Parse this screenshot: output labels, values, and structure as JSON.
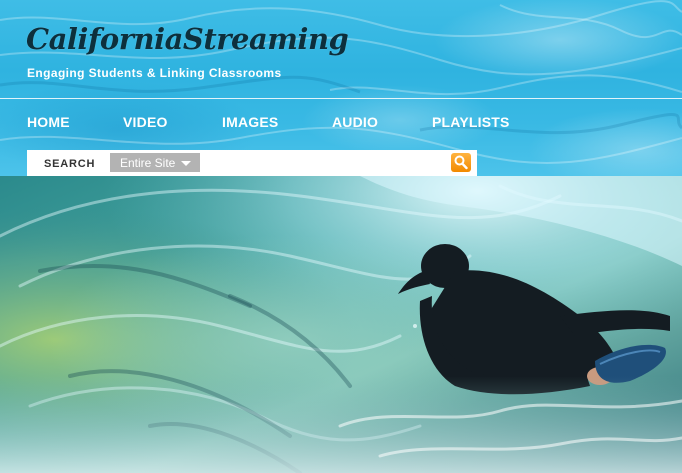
{
  "site": {
    "logo_text": "CaliforniaStreaming",
    "tagline": "Engaging Students & Linking Classrooms"
  },
  "nav": {
    "items": [
      {
        "label": "HOME"
      },
      {
        "label": "VIDEO"
      },
      {
        "label": "IMAGES"
      },
      {
        "label": "AUDIO"
      },
      {
        "label": "PLAYLISTS"
      }
    ]
  },
  "search": {
    "label": "SEARCH",
    "scope_selected": "Entire Site",
    "query": "",
    "button_icon": "magnifier-icon"
  },
  "hero": {
    "image_subject": "surfer inside a barreling wave"
  },
  "colors": {
    "header_blue": "#35b6e2",
    "logo_dark": "#0d2f3c",
    "search_button_orange": "#f28a00",
    "scope_gray": "#b3b3b3"
  }
}
